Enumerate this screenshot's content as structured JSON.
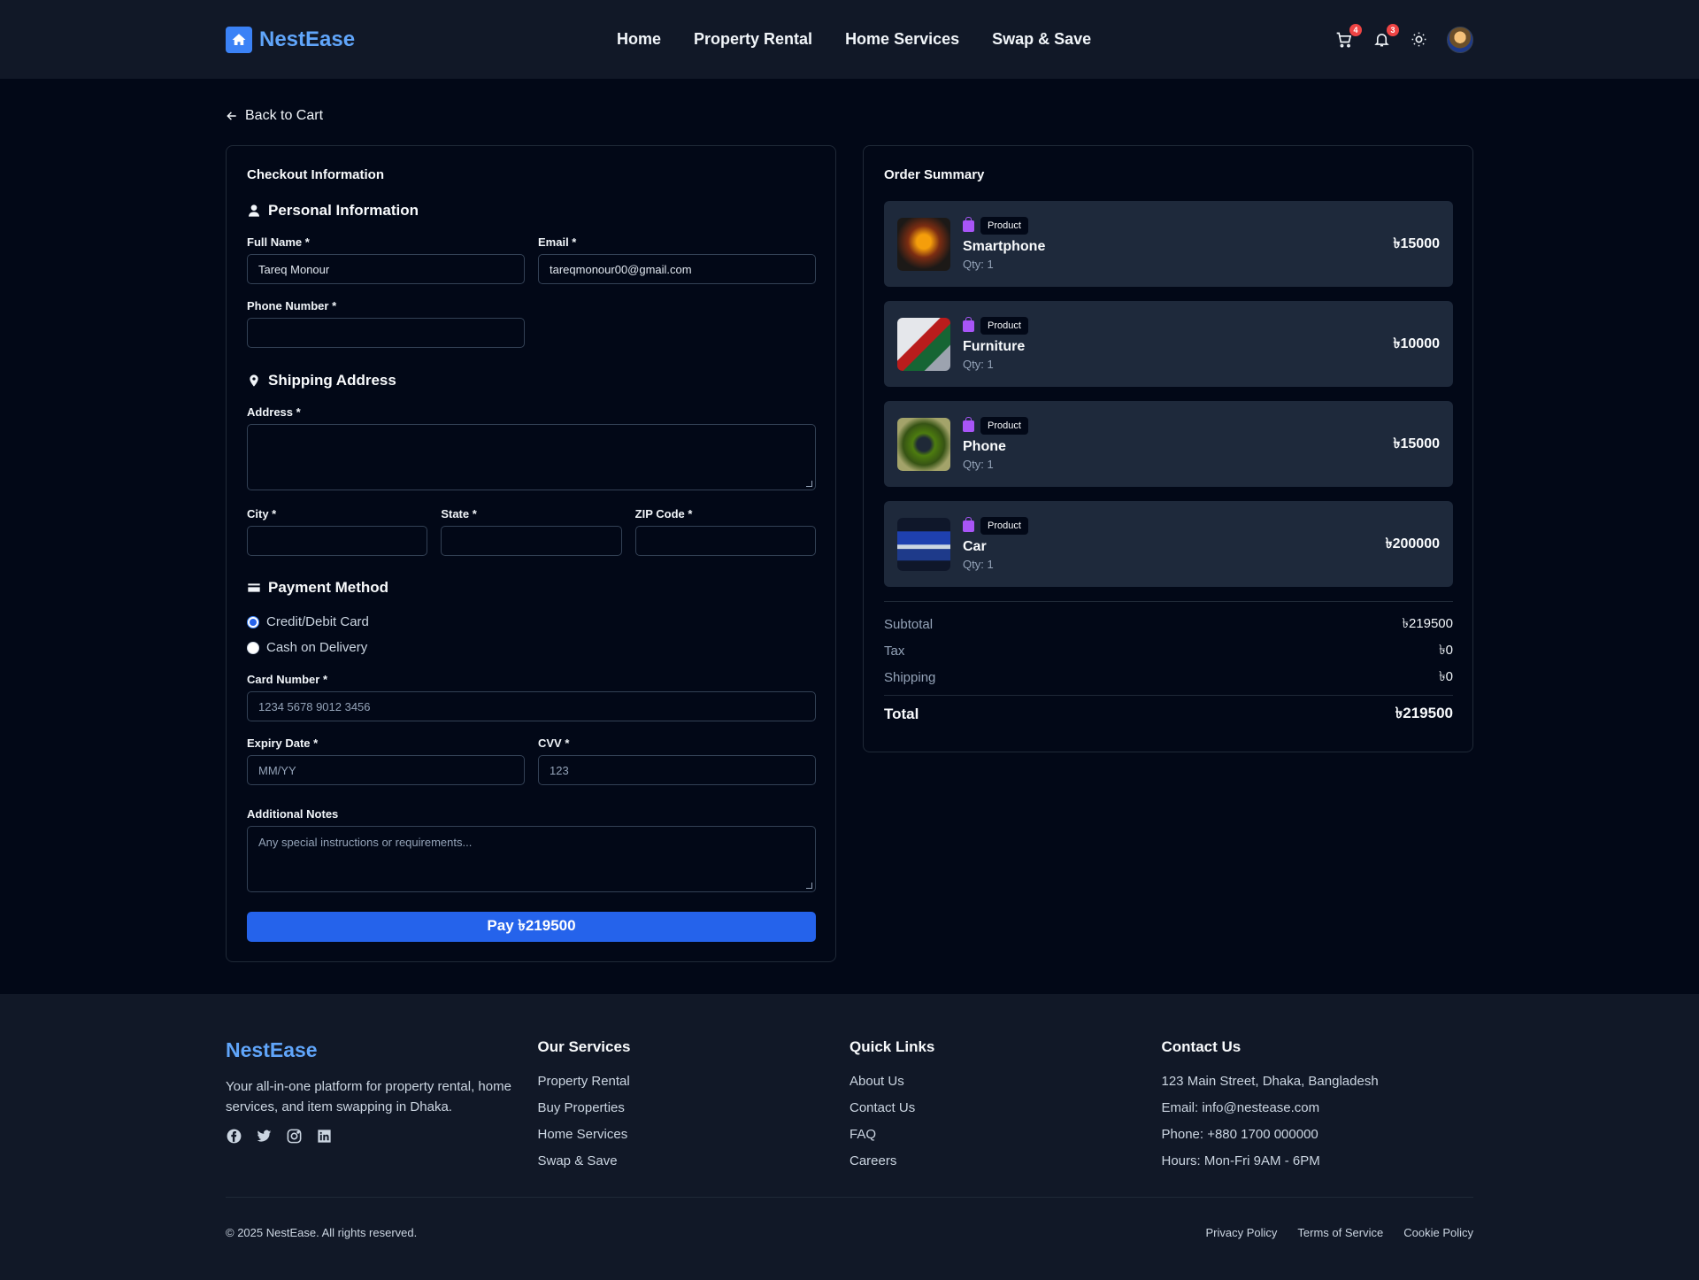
{
  "nav": {
    "brand": "NestEase",
    "links": [
      "Home",
      "Property Rental",
      "Home Services",
      "Swap & Save"
    ],
    "cart_count": "4",
    "notif_count": "3"
  },
  "back_label": "Back to Cart",
  "checkout": {
    "title": "Checkout Information",
    "personal": {
      "heading": "Personal Information",
      "full_name_label": "Full Name *",
      "full_name_value": "Tareq Monour",
      "email_label": "Email *",
      "email_value": "tareqmonour00@gmail.com",
      "phone_label": "Phone Number *",
      "phone_value": ""
    },
    "shipping": {
      "heading": "Shipping Address",
      "address_label": "Address *",
      "city_label": "City *",
      "state_label": "State *",
      "zip_label": "ZIP Code *"
    },
    "payment": {
      "heading": "Payment Method",
      "options": [
        "Credit/Debit Card",
        "Cash on Delivery"
      ],
      "selected": "Credit/Debit Card",
      "card_number_label": "Card Number *",
      "card_number_placeholder": "1234 5678 9012 3456",
      "expiry_label": "Expiry Date *",
      "expiry_placeholder": "MM/YY",
      "cvv_label": "CVV *",
      "cvv_placeholder": "123"
    },
    "notes_label": "Additional Notes",
    "notes_placeholder": "Any special instructions or requirements...",
    "pay_button": "Pay ৳219500"
  },
  "summary": {
    "title": "Order Summary",
    "items": [
      {
        "tag": "Product",
        "name": "Smartphone",
        "qty": "Qty: 1",
        "price": "৳15000"
      },
      {
        "tag": "Product",
        "name": "Furniture",
        "qty": "Qty: 1",
        "price": "৳10000"
      },
      {
        "tag": "Product",
        "name": "Phone",
        "qty": "Qty: 1",
        "price": "৳15000"
      },
      {
        "tag": "Product",
        "name": "Car",
        "qty": "Qty: 1",
        "price": "৳200000"
      }
    ],
    "subtotal_label": "Subtotal",
    "subtotal": "৳219500",
    "tax_label": "Tax",
    "tax": "৳0",
    "shipping_label": "Shipping",
    "shipping": "৳0",
    "total_label": "Total",
    "total": "৳219500"
  },
  "footer": {
    "brand": "NestEase",
    "description": "Your all-in-one platform for property rental, home services, and item swapping in Dhaka.",
    "services_heading": "Our Services",
    "services": [
      "Property Rental",
      "Buy Properties",
      "Home Services",
      "Swap & Save"
    ],
    "quick_heading": "Quick Links",
    "quick": [
      "About Us",
      "Contact Us",
      "FAQ",
      "Careers"
    ],
    "contact_heading": "Contact Us",
    "contact": [
      "123 Main Street, Dhaka, Bangladesh",
      "Email: info@nestease.com",
      "Phone: +880 1700 000000",
      "Hours: Mon-Fri 9AM - 6PM"
    ],
    "copyright": "© 2025 NestEase. All rights reserved.",
    "legal": [
      "Privacy Policy",
      "Terms of Service",
      "Cookie Policy"
    ]
  },
  "colors": {
    "accent": "#2563eb",
    "brand": "#60a5fa",
    "badge": "#ef4444",
    "tag_icon": "#a855f7"
  }
}
